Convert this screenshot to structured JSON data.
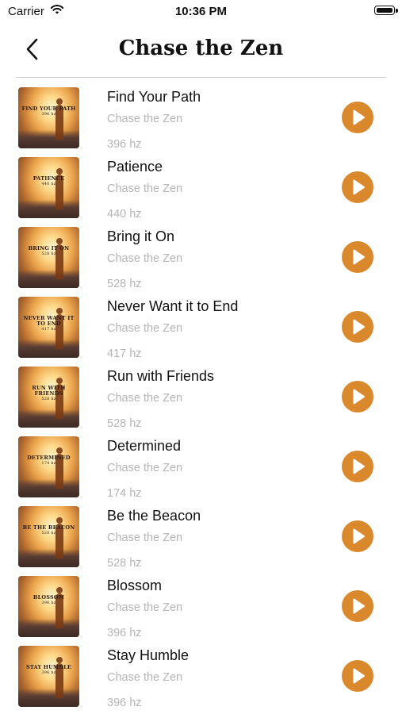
{
  "status_bar": {
    "carrier": "Carrier",
    "time": "10:36 PM"
  },
  "nav": {
    "title": "Chase the Zen"
  },
  "tracks": [
    {
      "title": "Find Your Path",
      "artist": "Chase the Zen",
      "frequency": "396 hz",
      "art_title": "FIND YOUR PATH",
      "art_hz": "396 hz"
    },
    {
      "title": "Patience",
      "artist": "Chase the Zen",
      "frequency": "440 hz",
      "art_title": "PATIENCE",
      "art_hz": "440 hz"
    },
    {
      "title": "Bring it On",
      "artist": "Chase the Zen",
      "frequency": "528 hz",
      "art_title": "BRING IT ON",
      "art_hz": "528 hz"
    },
    {
      "title": "Never Want it to End",
      "artist": "Chase the Zen",
      "frequency": "417 hz",
      "art_title": "NEVER WANT IT TO END",
      "art_hz": "417 hz"
    },
    {
      "title": "Run with Friends",
      "artist": "Chase the Zen",
      "frequency": "528 hz",
      "art_title": "RUN WITH FRIENDS",
      "art_hz": "528 hz"
    },
    {
      "title": "Determined",
      "artist": "Chase the Zen",
      "frequency": "174 hz",
      "art_title": "DETERMINED",
      "art_hz": "174 hz"
    },
    {
      "title": "Be the Beacon",
      "artist": "Chase the Zen",
      "frequency": "528 hz",
      "art_title": "BE THE BEACON",
      "art_hz": "528 hz"
    },
    {
      "title": "Blossom",
      "artist": "Chase the Zen",
      "frequency": "396 hz",
      "art_title": "BLOSSOM",
      "art_hz": "396 hz"
    },
    {
      "title": "Stay Humble",
      "artist": "Chase the Zen",
      "frequency": "396 hz",
      "art_title": "STAY HUMBLE",
      "art_hz": "396 hz"
    }
  ],
  "colors": {
    "accent": "#d9892b",
    "secondary_text": "#b5b5b5"
  },
  "icons": {
    "back": "chevron-left-icon",
    "play": "play-icon",
    "wifi": "wifi-icon",
    "battery": "battery-icon"
  }
}
